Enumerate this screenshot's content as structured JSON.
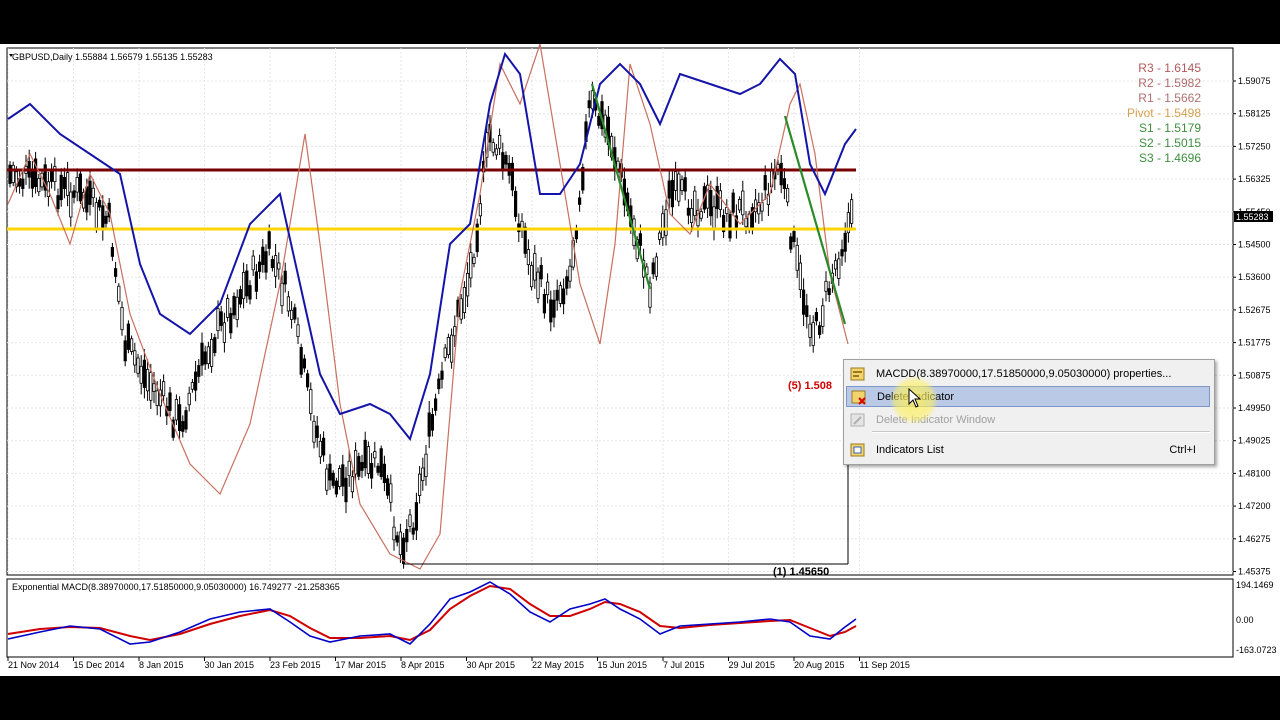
{
  "chart": {
    "symbol_header": "GBPUSD,Daily  1.55884 1.56579 1.55135 1.55283",
    "current_price": "1.55283",
    "price_axis": [
      "1.59075",
      "1.58125",
      "1.57250",
      "1.56325",
      "1.55450",
      "1.54500",
      "1.53600",
      "1.52675",
      "1.51775",
      "1.50875",
      "1.49950",
      "1.49025",
      "1.48100",
      "1.47200",
      "1.46275",
      "1.45375"
    ],
    "pivots": [
      {
        "label": "R3 - 1.6145",
        "color": "#b05a5a"
      },
      {
        "label": "R2 - 1.5982",
        "color": "#b06a6a"
      },
      {
        "label": "R1 - 1.5662",
        "color": "#b07070"
      },
      {
        "label": "Pivot - 1.5498",
        "color": "#d8a050"
      },
      {
        "label": "S1 - 1.5179",
        "color": "#3f8f3f"
      },
      {
        "label": "S2 - 1.5015",
        "color": "#3f8f3f"
      },
      {
        "label": "S3 - 1.4696",
        "color": "#3f8f3f"
      }
    ],
    "annotation_top": "(5)  1.508",
    "annotation_bottom": "(1)  1.45650",
    "indicator_header": "Exponential MACD(8.38970000,17.51850000,9.05030000) 16.749277 -21.258365",
    "indicator_axis": [
      "194.1469",
      "0.00",
      "-163.0723"
    ],
    "date_axis": [
      "21 Nov 2014",
      "15 Dec 2014",
      "8 Jan 2015",
      "30 Jan 2015",
      "23 Feb 2015",
      "17 Mar 2015",
      "8 Apr 2015",
      "30 Apr 2015",
      "22 May 2015",
      "15 Jun 2015",
      "7 Jul 2015",
      "29 Jul 2015",
      "20 Aug 2015",
      "11 Sep 2015"
    ],
    "colors": {
      "resistance": "#7a0000",
      "support": "#ffd400",
      "bollinger": "#1414a8",
      "envelope": "#c87060",
      "trend": "#2a8a2a",
      "macd": "#0000c8",
      "signal": "#d00000"
    }
  },
  "context_menu": {
    "items": [
      {
        "label": "MACDD(8.38970000,17.51850000,9.05030000) properties...",
        "shortcut": "",
        "icon": "properties-icon",
        "state": "normal"
      },
      {
        "label": "Delete Indicator",
        "shortcut": "",
        "icon": "delete-indicator-icon",
        "state": "highlighted"
      },
      {
        "label": "Delete Indicator Window",
        "shortcut": "",
        "icon": "delete-window-icon",
        "state": "disabled"
      },
      {
        "label": "Indicators List",
        "shortcut": "Ctrl+I",
        "icon": "indicators-list-icon",
        "state": "normal"
      }
    ]
  }
}
